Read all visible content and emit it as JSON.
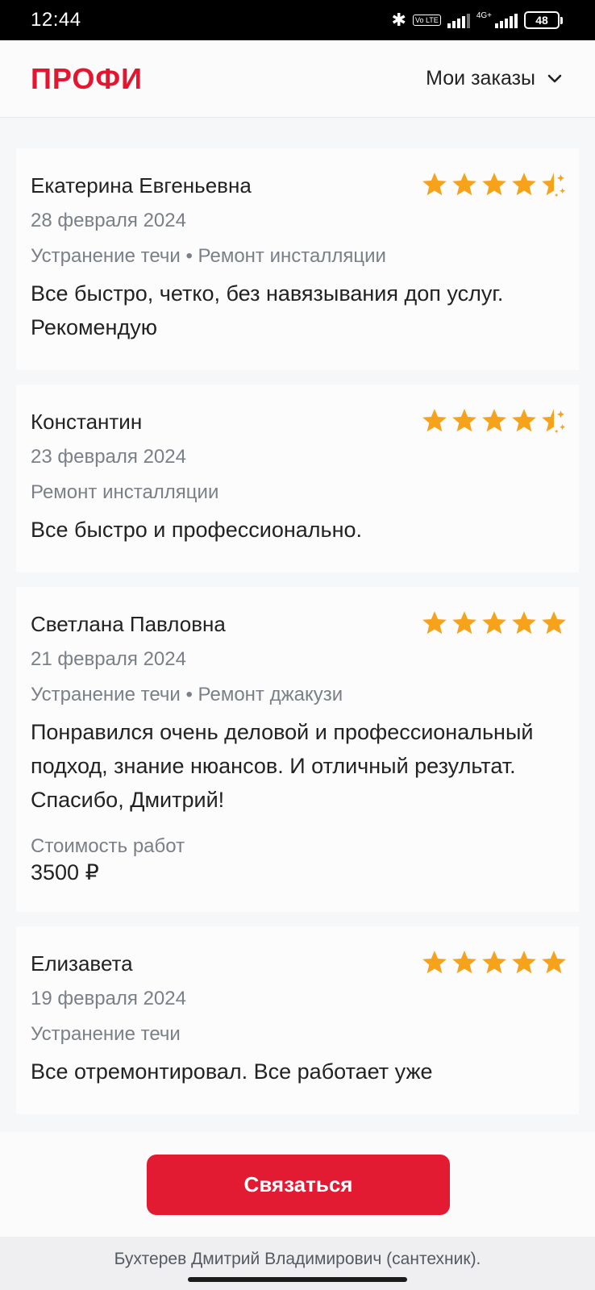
{
  "status_bar": {
    "time": "12:44",
    "network": "4G+",
    "volte": "Vo LTE",
    "battery": "48",
    "icons": [
      "bluetooth-icon",
      "volte-icon",
      "signal-icon",
      "signal-4g-icon",
      "battery-icon"
    ]
  },
  "header": {
    "logo": "ПРОФИ",
    "orders_label": "Мои заказы",
    "brand_color": "#e4162f"
  },
  "reviews": [
    {
      "name": "Екатерина Евгеньевна",
      "rating": 4.5,
      "date": "28 февраля 2024",
      "services": "Устранение течи • Ремонт инсталляции",
      "text": "Все быстро, четко, без навязывания доп услуг. Рекомендую"
    },
    {
      "name": "Константин",
      "rating": 4.5,
      "date": "23 февраля 2024",
      "services": "Ремонт инсталляции",
      "text": "Все быстро и профессионально."
    },
    {
      "name": "Светлана Павловна",
      "rating": 5,
      "date": "21 февраля 2024",
      "services": "Устранение течи • Ремонт джакузи",
      "text": "Понравился очень деловой и профессиональный подход, знание нюансов. И отличный результат. Спасибо, Дмитрий!",
      "cost_label": "Стоимость работ",
      "cost": "3500 ₽"
    },
    {
      "name": "Елизавета",
      "rating": 5,
      "date": "19 февраля 2024",
      "services": "Устранение течи",
      "text": "Все отремонтировал. Все работает уже"
    }
  ],
  "star_color": "#f7a21b",
  "contact_button": "Связаться",
  "footer": "Бухтерев Дмитрий Владимирович (сантехник)."
}
